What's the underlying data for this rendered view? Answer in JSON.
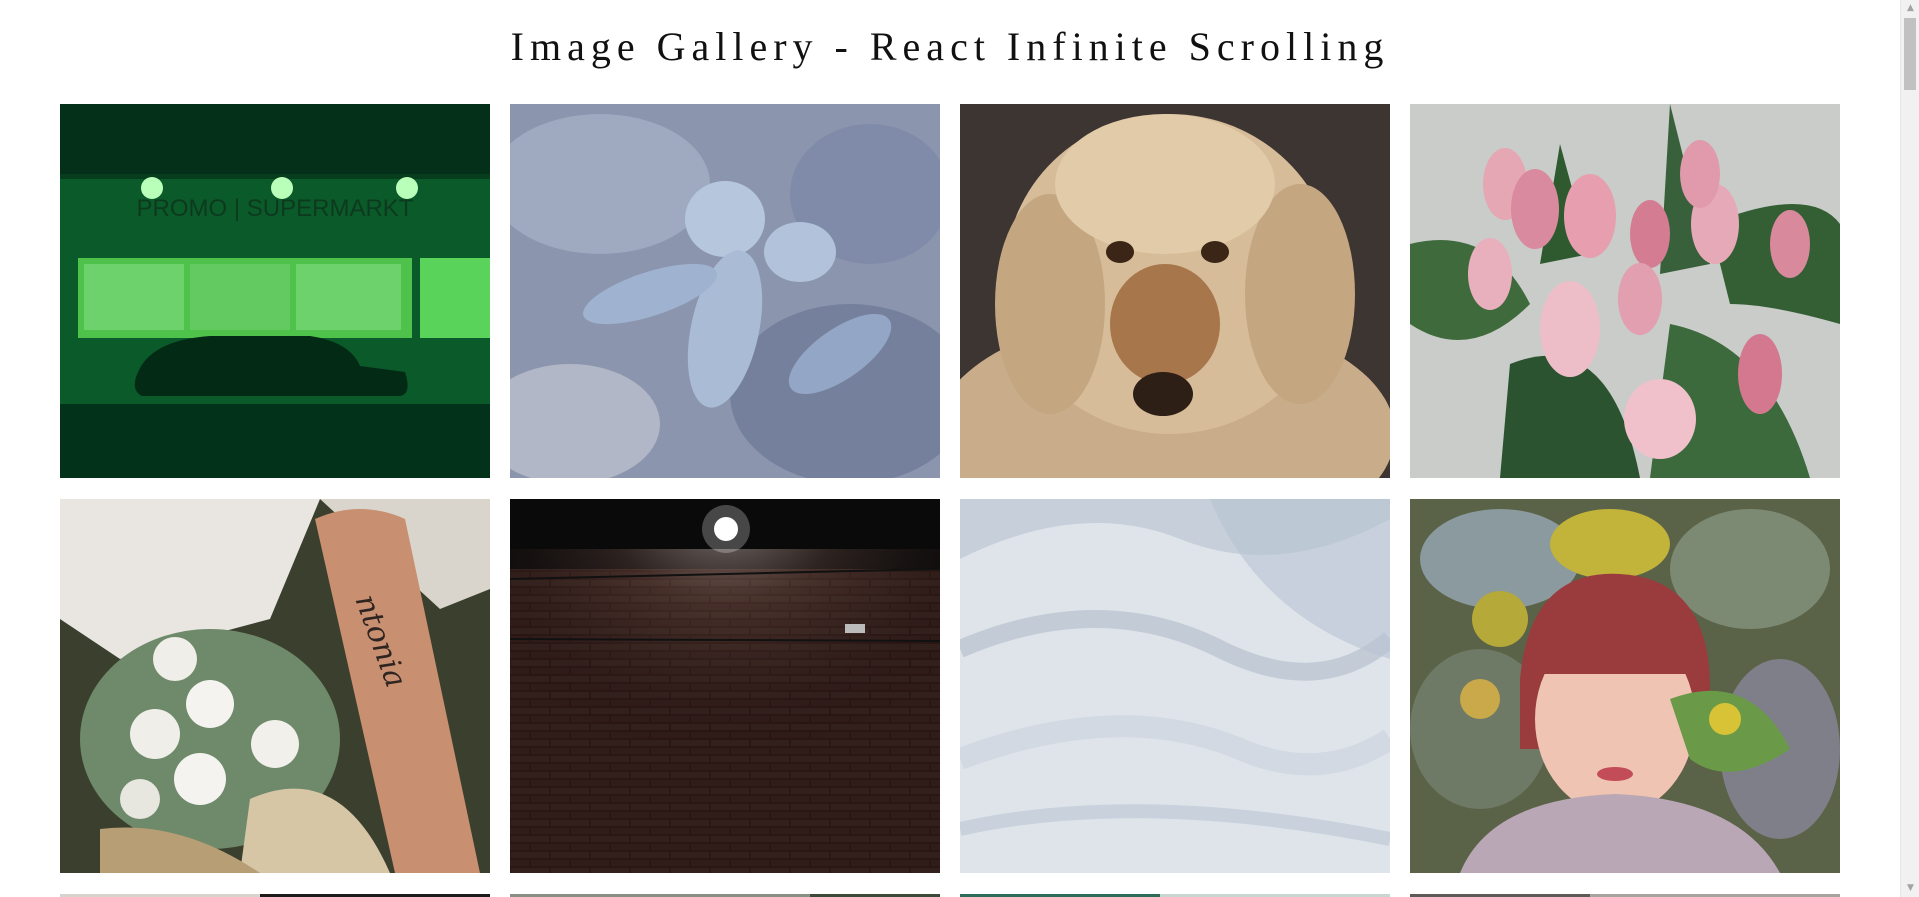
{
  "page": {
    "title": "Image Gallery - React Infinite Scrolling"
  },
  "gallery": {
    "items": [
      {
        "subject": "green-lit supermarket storefront at night",
        "storefront_sign": "PROMO | SUPERMARKT"
      },
      {
        "subject": "blue cactus closeup"
      },
      {
        "subject": "fluffy golden doodle dog portrait"
      },
      {
        "subject": "pink tulip bouquet"
      },
      {
        "subject": "tattooed arm with white rose bouquet",
        "tattoo_text": "ntonia"
      },
      {
        "subject": "dark brick wall lit by a single lamp with security camera"
      },
      {
        "subject": "white snow dunes"
      },
      {
        "subject": "red-haired woman lying in wildflowers"
      }
    ]
  },
  "colors": {
    "background": "#ffffff",
    "title": "#111111",
    "scrollbar_track": "#f1f1f1",
    "scrollbar_thumb": "#c1c1c1"
  },
  "scrollbar": {
    "up_icon": "triangle-up",
    "down_icon": "triangle-down",
    "scroll_position": 0.0
  }
}
